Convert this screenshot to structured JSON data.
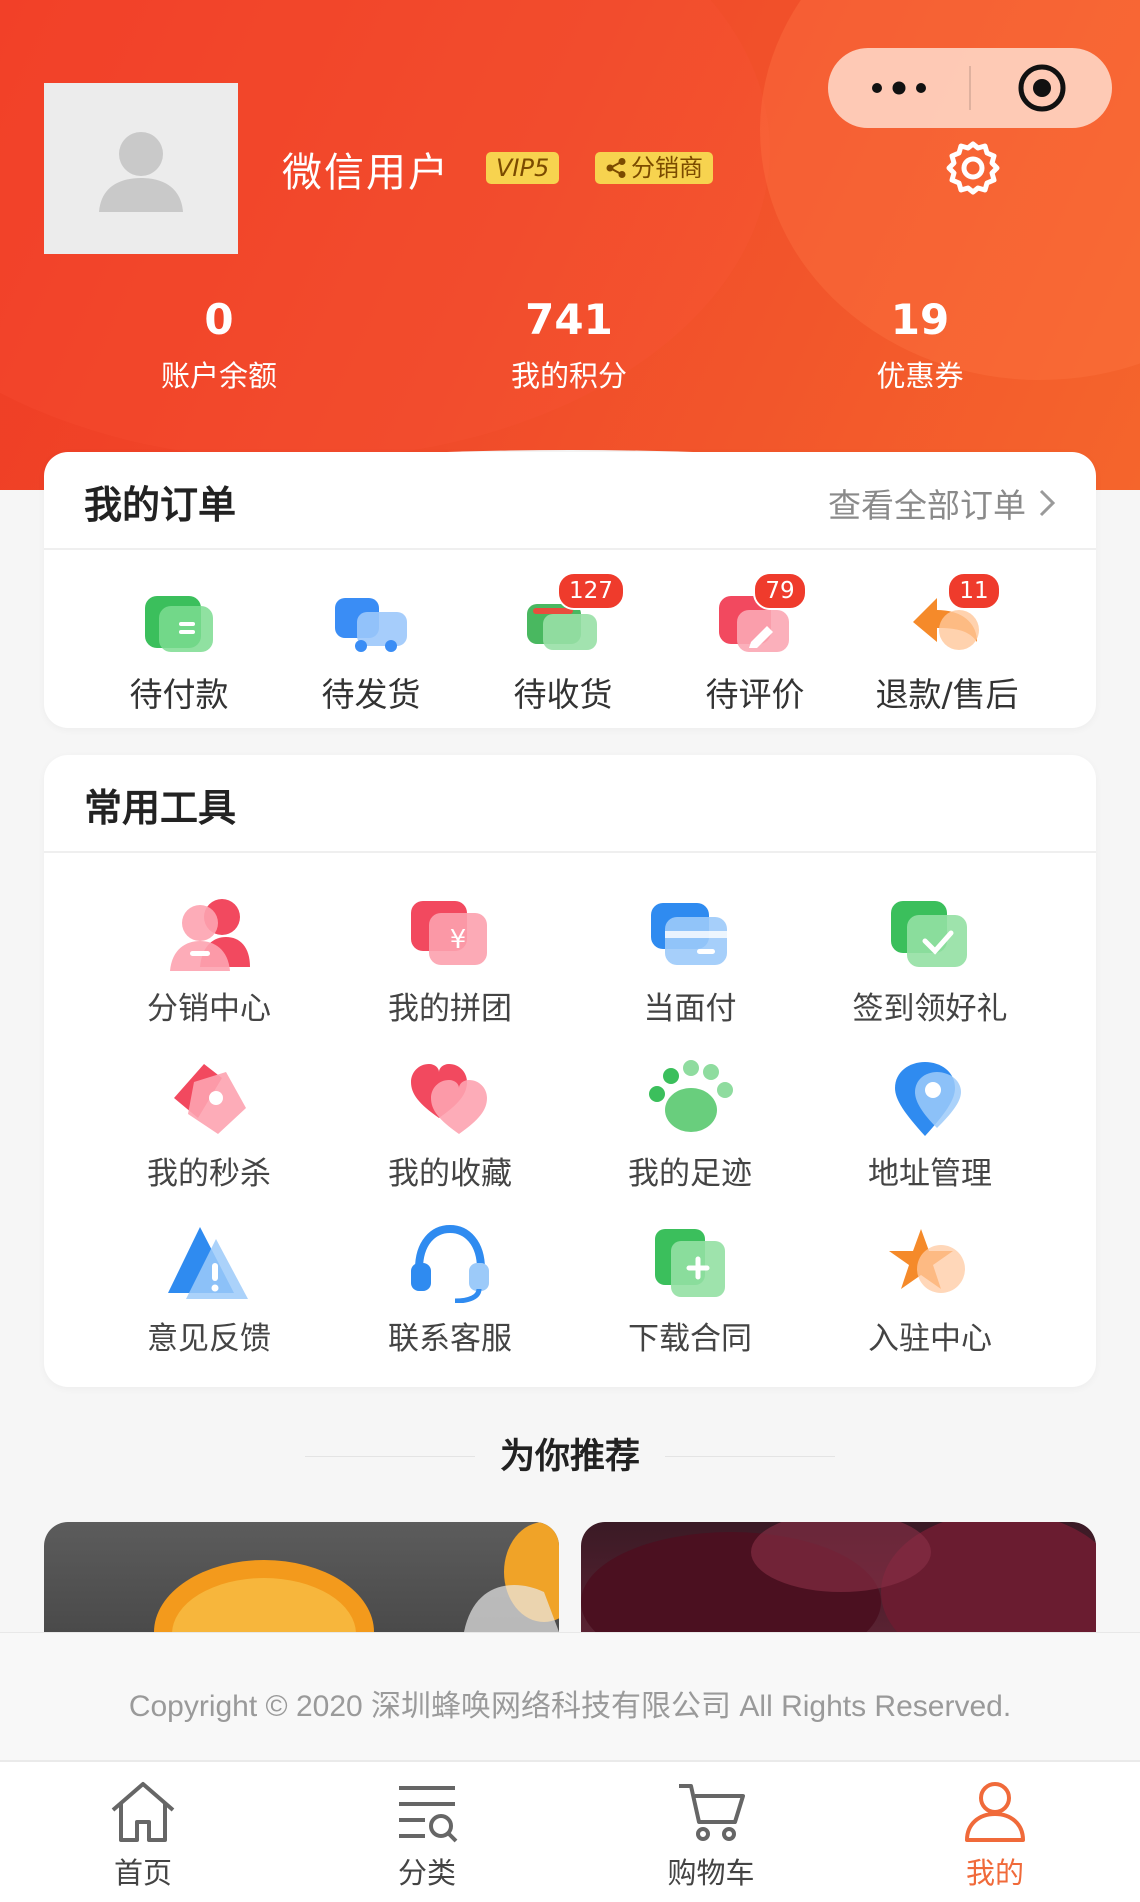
{
  "header": {
    "username": "微信用户",
    "vip_label": "VIP5",
    "distributor_label": "分销商"
  },
  "stats": [
    {
      "value": "0",
      "label": "账户余额"
    },
    {
      "value": "741",
      "label": "我的积分"
    },
    {
      "value": "19",
      "label": "优惠券"
    }
  ],
  "orders": {
    "title": "我的订单",
    "view_all": "查看全部订单",
    "items": [
      {
        "label": "待付款",
        "badge": "",
        "icon": "wallet-icon",
        "color": "#3bbf5c"
      },
      {
        "label": "待发货",
        "badge": "",
        "icon": "truck-icon",
        "color": "#3a8df5"
      },
      {
        "label": "待收货",
        "badge": "127",
        "icon": "package-icon",
        "color": "#49b860"
      },
      {
        "label": "待评价",
        "badge": "79",
        "icon": "review-icon",
        "color": "#f2495f"
      },
      {
        "label": "退款/售后",
        "badge": "11",
        "icon": "refund-icon",
        "color": "#f58a2a"
      }
    ]
  },
  "tools": {
    "title": "常用工具",
    "items": [
      {
        "label": "分销中心",
        "icon": "users-icon",
        "color": "#f2495f"
      },
      {
        "label": "我的拼团",
        "icon": "group-buy-icon",
        "color": "#f2495f"
      },
      {
        "label": "当面付",
        "icon": "card-icon",
        "color": "#2f8bf0"
      },
      {
        "label": "签到领好礼",
        "icon": "checkin-icon",
        "color": "#3bbf5c"
      },
      {
        "label": "我的秒杀",
        "icon": "flash-sale-icon",
        "color": "#f2495f"
      },
      {
        "label": "我的收藏",
        "icon": "heart-icon",
        "color": "#f2495f"
      },
      {
        "label": "我的足迹",
        "icon": "footprint-icon",
        "color": "#3bbf5c"
      },
      {
        "label": "地址管理",
        "icon": "location-icon",
        "color": "#2f8bf0"
      },
      {
        "label": "意见反馈",
        "icon": "warning-icon",
        "color": "#2f8bf0"
      },
      {
        "label": "联系客服",
        "icon": "headset-icon",
        "color": "#2f8bf0"
      },
      {
        "label": "下载合同",
        "icon": "download-doc-icon",
        "color": "#3bbf5c"
      },
      {
        "label": "入驻中心",
        "icon": "star-icon",
        "color": "#f58a2a"
      }
    ]
  },
  "recommend": {
    "title": "为你推荐"
  },
  "footer": {
    "copyright": "Copyright © 2020 深圳蜂唤网络科技有限公司 All Rights Reserved."
  },
  "tabbar": [
    {
      "label": "首页",
      "icon": "home-icon",
      "active": false
    },
    {
      "label": "分类",
      "icon": "category-icon",
      "active": false
    },
    {
      "label": "购物车",
      "icon": "cart-icon",
      "active": false
    },
    {
      "label": "我的",
      "icon": "user-icon",
      "active": true
    }
  ],
  "colors": {
    "brand": "#ef3b24",
    "accent": "#f06a3a",
    "badge": "#ef3b2c",
    "vip": "#f7d34f"
  }
}
